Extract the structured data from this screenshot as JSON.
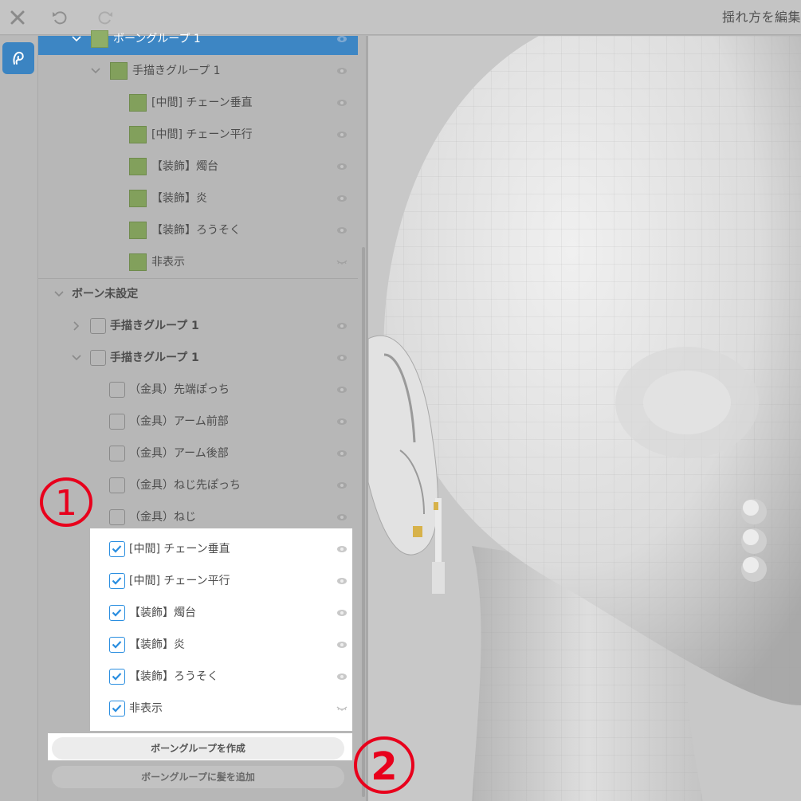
{
  "topbar": {
    "close_icon": "close-icon",
    "undo_icon": "undo-icon",
    "redo_icon": "redo-icon",
    "title": "揺れ方を編集"
  },
  "toolstrip": {
    "active_tool_icon": "hair-tool-icon"
  },
  "tree": {
    "selected_group": {
      "label": "ボーングループ 1"
    },
    "sub_group": {
      "label": "手描きグループ 1"
    },
    "group_items": [
      {
        "label": "[中間] チェーン垂直"
      },
      {
        "label": "[中間] チェーン平行"
      },
      {
        "label": "【装飾】燭台"
      },
      {
        "label": "【装飾】炎"
      },
      {
        "label": "【装飾】ろうそく"
      },
      {
        "label": "非表示"
      }
    ],
    "unassigned": {
      "label": "ボーン未設定",
      "groups": [
        {
          "label": "手描きグループ 1",
          "expanded": false
        },
        {
          "label": "手描きグループ 1",
          "expanded": true
        }
      ],
      "unchecked_items": [
        {
          "label": "（金具）先端ぽっち"
        },
        {
          "label": "（金具）アーム前部"
        },
        {
          "label": "（金具）アーム後部"
        },
        {
          "label": "（金具）ねじ先ぽっち"
        },
        {
          "label": "（金具）ねじ"
        }
      ],
      "checked_items": [
        {
          "label": "[中間] チェーン垂直"
        },
        {
          "label": "[中間] チェーン平行"
        },
        {
          "label": "【装飾】燭台"
        },
        {
          "label": "【装飾】炎"
        },
        {
          "label": "【装飾】ろうそく"
        },
        {
          "label": "非表示"
        }
      ]
    }
  },
  "buttons": {
    "create_group": "ボーングループを作成",
    "add_hair": "ボーングループに髪を追加"
  },
  "annotations": {
    "mark_1": "1",
    "mark_2": "2",
    "color": "#e8001c"
  },
  "colors": {
    "accent": "#3d86c4",
    "swatch": "#82a05c",
    "check": "#2a8ee0"
  }
}
